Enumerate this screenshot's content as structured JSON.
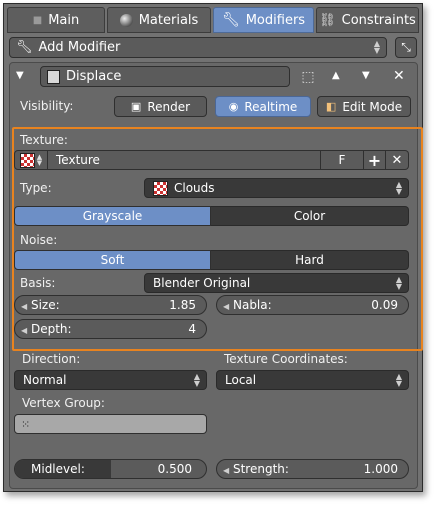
{
  "tabs": [
    "Main",
    "Materials",
    "Modifiers",
    "Constraints"
  ],
  "add_modifier": "Add Modifier",
  "modifier_name": "Displace",
  "visibility": {
    "label": "Visibility:",
    "render": "Render",
    "realtime": "Realtime",
    "edit_mode": "Edit Mode"
  },
  "texture": {
    "label": "Texture:",
    "name": "Texture",
    "fake_user": "F"
  },
  "type": {
    "label": "Type:",
    "value": "Clouds"
  },
  "color_mode": {
    "options": [
      "Grayscale",
      "Color"
    ],
    "selected": "Grayscale"
  },
  "noise": {
    "label": "Noise:",
    "options": [
      "Soft",
      "Hard"
    ],
    "selected": "Soft"
  },
  "basis": {
    "label": "Basis:",
    "value": "Blender Original"
  },
  "size": {
    "label": "Size:",
    "value": "1.85"
  },
  "nabla": {
    "label": "Nabla:",
    "value": "0.09"
  },
  "depth": {
    "label": "Depth:",
    "value": "4"
  },
  "direction": {
    "label": "Direction:",
    "value": "Normal"
  },
  "texture_coordinates": {
    "label": "Texture Coordinates:",
    "value": "Local"
  },
  "vertex_group": {
    "label": "Vertex Group:"
  },
  "midlevel": {
    "label": "Midlevel:",
    "value": "0.500",
    "fraction": 0.5
  },
  "strength": {
    "label": "Strength:",
    "value": "1.000"
  },
  "colors": {
    "accent": "#6d8fc6",
    "highlight": "#e8831f"
  }
}
